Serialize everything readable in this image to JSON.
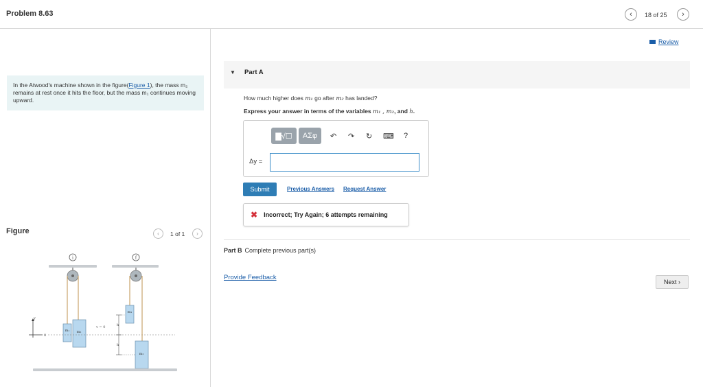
{
  "header": {
    "title": "Problem 8.63",
    "nav_count": "18 of 25",
    "prev_symbol": "‹",
    "next_symbol": "›"
  },
  "review": {
    "label": "Review"
  },
  "intro": {
    "text_before": "In the Atwood's machine shown in the figure(",
    "figure_link": "Figure 1",
    "text_after": "), the mass m₂ remains at rest once it hits the floor, but the mass m₁ continues moving upward."
  },
  "figure": {
    "label": "Figure",
    "pager": "1 of 1",
    "left_pulley_mark": "i",
    "right_pulley_mark": "f",
    "left_m1": "m₁",
    "left_m2": "m₂",
    "right_m1": "m₁",
    "right_m2": "m₂",
    "v_label": "v = 0",
    "y_axis": "y",
    "x_axis": "0",
    "h_label_top": "h",
    "h_label_bottom": "h"
  },
  "partA": {
    "label": "Part A",
    "question_before": "How much higher does ",
    "question_var1": "m₁",
    "question_mid": " go after ",
    "question_var2": "m₂",
    "question_after": " has landed?",
    "express_before": "Express your answer in terms of the variables ",
    "express_vars": "m₁ , m₂",
    "express_mid": ", and ",
    "express_var_h": "h",
    "express_end": ".",
    "input_label": "Δy =",
    "input_value": "",
    "toolbar": {
      "templates": "▇√☐",
      "greek": "ΑΣφ",
      "undo": "↶",
      "redo": "↷",
      "reset": "↻",
      "keyboard": "⌨",
      "help": "?"
    },
    "submit": "Submit",
    "previous_answers": "Previous Answers",
    "request_answer": "Request Answer",
    "feedback": "Incorrect; Try Again; 6 attempts remaining",
    "feedback_icon": "✖"
  },
  "partB": {
    "label": "Part B",
    "text": "Complete previous part(s)"
  },
  "provide_feedback": "Provide Feedback",
  "next_button": "Next",
  "colors": {
    "accent": "#2e7db5",
    "link": "#1a5da8",
    "error": "#d4313b",
    "intro_bg": "#e9f4f5"
  }
}
